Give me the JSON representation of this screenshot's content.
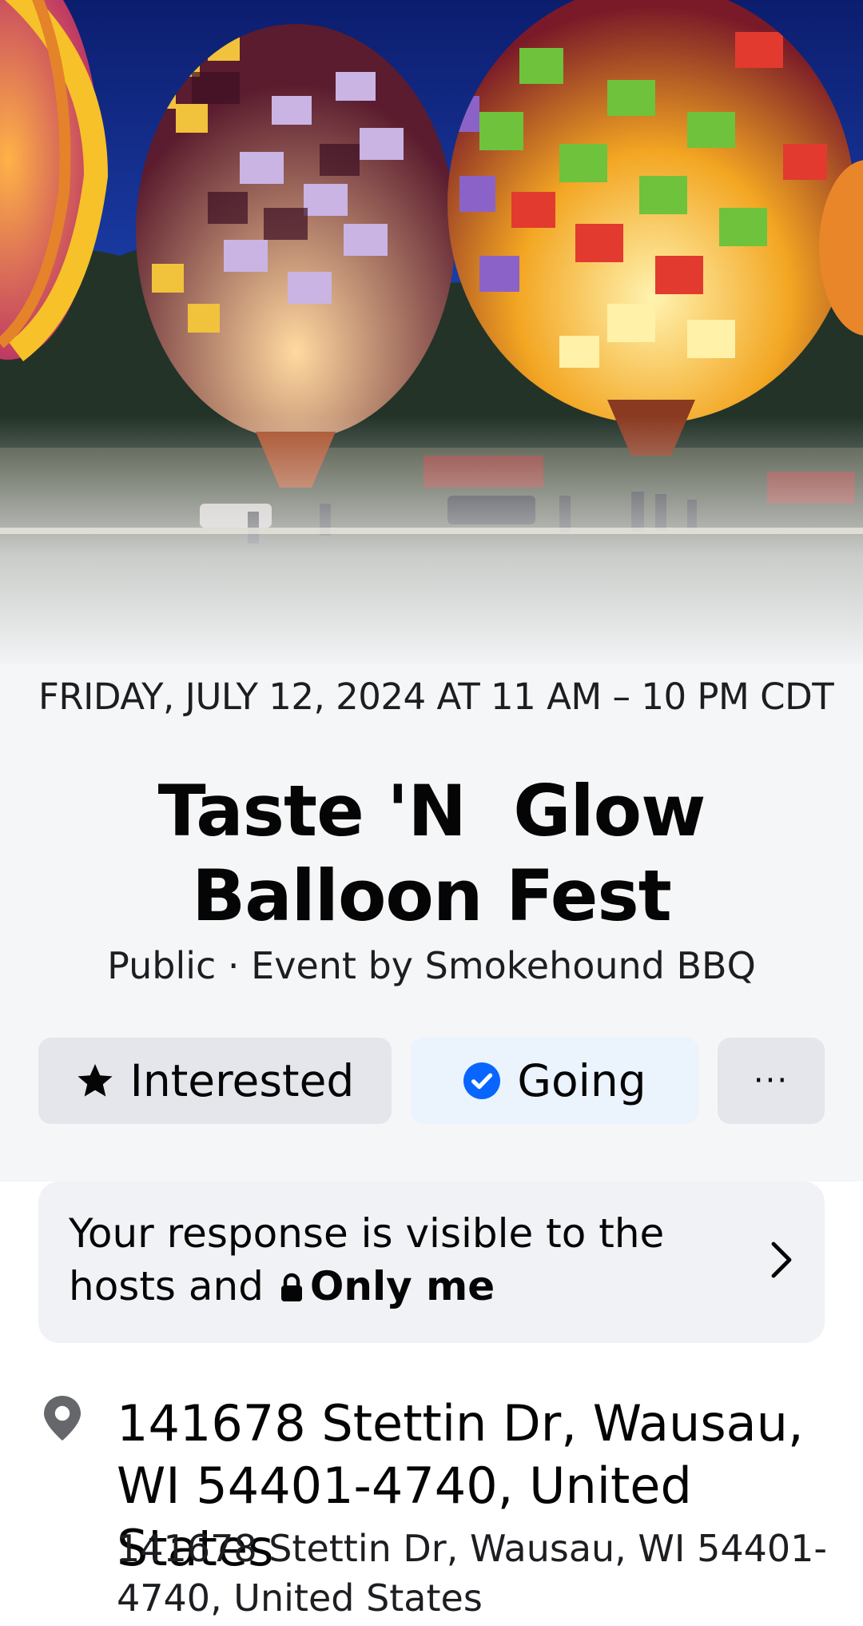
{
  "cover": {
    "image": "hot-air-balloons-night-photo"
  },
  "event": {
    "date": "FRIDAY, JULY 12, 2024 AT 11 AM – 10 PM CDT",
    "title": "Taste 'N  Glow Balloon Fest",
    "subtitle": "Public · Event by Smokehound BBQ"
  },
  "actions": {
    "interested_label": "Interested",
    "going_label": "Going",
    "more_label": "···"
  },
  "visibility": {
    "text_prefix": "Your response is visible to the hosts and",
    "audience": "Only me"
  },
  "location": {
    "name": "141678 Stettin Dr, Wausau, WI 54401-4740, United States",
    "address": "141678 Stettin Dr, Wausau, WI 54401-4740, United States"
  },
  "colors": {
    "accent": "#0866ff",
    "button_gray": "#e4e6eb",
    "going_bg": "#ebf3fd",
    "page_bg": "#f5f6f8",
    "icon_gray": "#65676b"
  }
}
